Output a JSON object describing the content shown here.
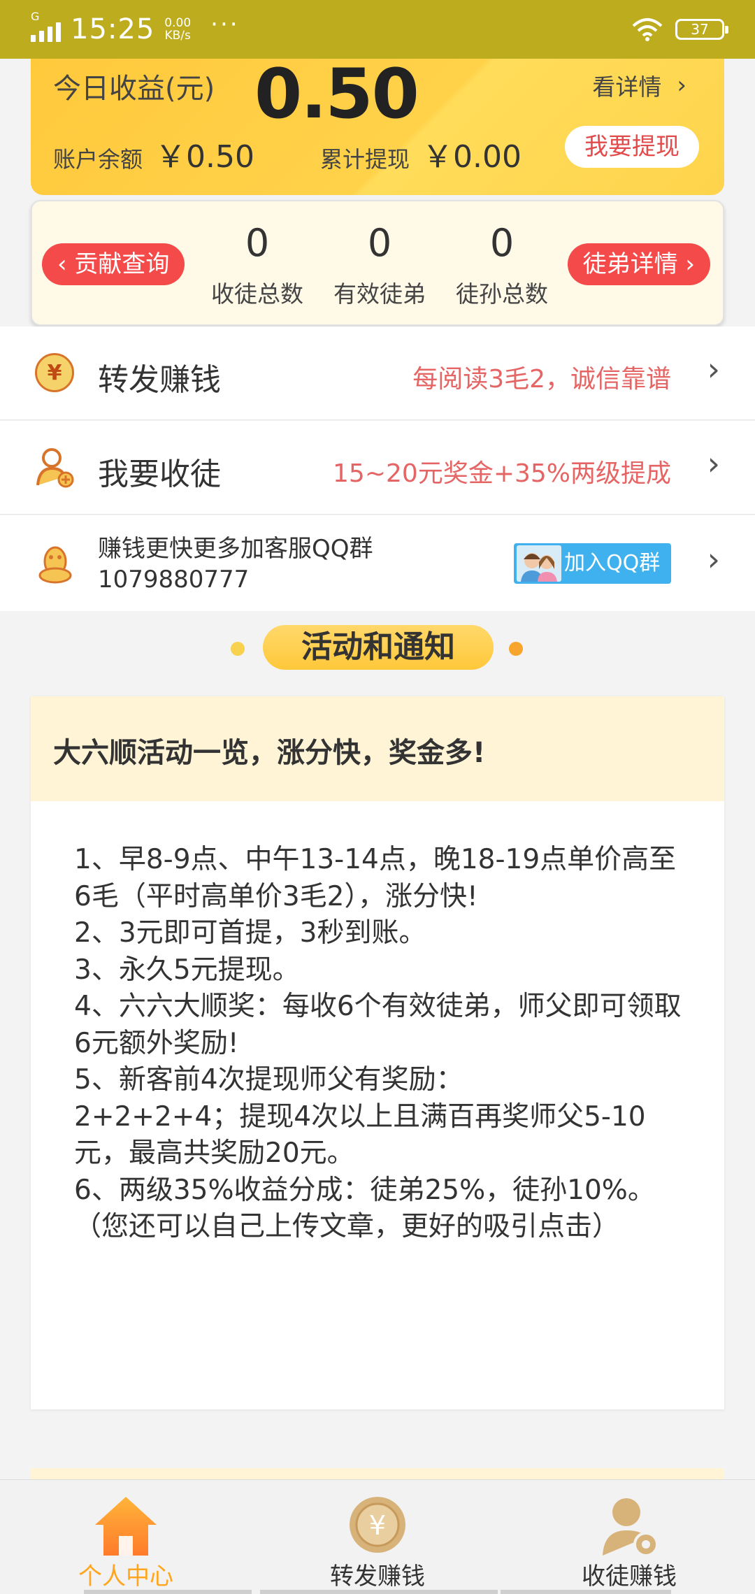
{
  "status_bar": {
    "network": "G",
    "time": "15:25",
    "speed_value": "0.00",
    "speed_unit": "KB/s",
    "more": "···",
    "battery": "37"
  },
  "earnings": {
    "today_label": "今日收益(元)",
    "today_amount": "0.50",
    "detail_link": "看详情",
    "balance_label": "账户余额",
    "balance_value": "￥0.50",
    "cumulative_label": "累计提现",
    "cumulative_value": "￥0.00",
    "withdraw_button": "我要提现"
  },
  "stats": {
    "contribution_button": "贡献查询",
    "apprentice_detail_button": "徒弟详情",
    "items": [
      {
        "value": "0",
        "label": "收徒总数"
      },
      {
        "value": "0",
        "label": "有效徒弟"
      },
      {
        "value": "0",
        "label": "徒孙总数"
      }
    ]
  },
  "menu": {
    "share": {
      "title": "转发赚钱",
      "hint": "每阅读3毛2，诚信靠谱",
      "icon": "yuan-coin-icon"
    },
    "recruit": {
      "title": "我要收徒",
      "hint": "15~20元奖金+35%两级提成",
      "icon": "add-user-icon"
    },
    "qq": {
      "line1": "赚钱更快更多加客服QQ群",
      "line2": "1079880777",
      "button": "加入QQ群",
      "icon": "qq-penguin-icon"
    }
  },
  "activity": {
    "section_title": "活动和通知",
    "card_title": "大六顺活动一览，涨分快，奖金多!",
    "lines": [
      "1、早8-9点、中午13-14点，晚18-19点单价高至6毛（平时高单价3毛2），涨分快!",
      "2、3元即可首提，3秒到账。",
      "3、永久5元提现。",
      "4、六六大顺奖：每收6个有效徒弟，师父即可领取6元额外奖励!",
      "5、新客前4次提现师父有奖励：",
      "2+2+2+4；提现4次以上且满百再奖师父5-10元，最高共奖励20元。",
      "6、两级35%收益分成：徒弟25%，徒孙10%。",
      "（您还可以自己上传文章，更好的吸引点击）"
    ]
  },
  "tabs": [
    {
      "label": "个人中心",
      "icon": "home-icon"
    },
    {
      "label": "转发赚钱",
      "icon": "yuan-coin-icon"
    },
    {
      "label": "收徒赚钱",
      "icon": "user-gear-icon"
    }
  ],
  "colors": {
    "status_bar": "#bdac1e",
    "card_yellow": "#ffd24a",
    "accent_red": "#f44a4a",
    "hint_red": "#e56565",
    "tab_active": "#ffa61e"
  }
}
